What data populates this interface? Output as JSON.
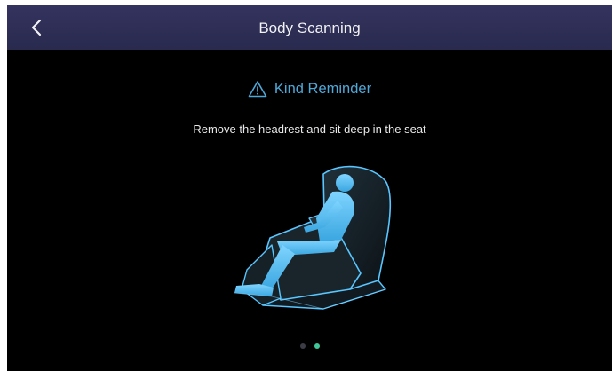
{
  "header": {
    "title": "Body Scanning",
    "back_icon": "chevron-left-icon"
  },
  "reminder": {
    "icon": "warning-icon",
    "label": "Kind Reminder",
    "color": "#4fa8d8"
  },
  "instruction": "Remove the headrest and sit deep in the seat",
  "illustration": {
    "name": "massage-chair-with-seated-person"
  },
  "pagination": {
    "total": 2,
    "active_index": 1,
    "active_color": "#3fc79a"
  }
}
